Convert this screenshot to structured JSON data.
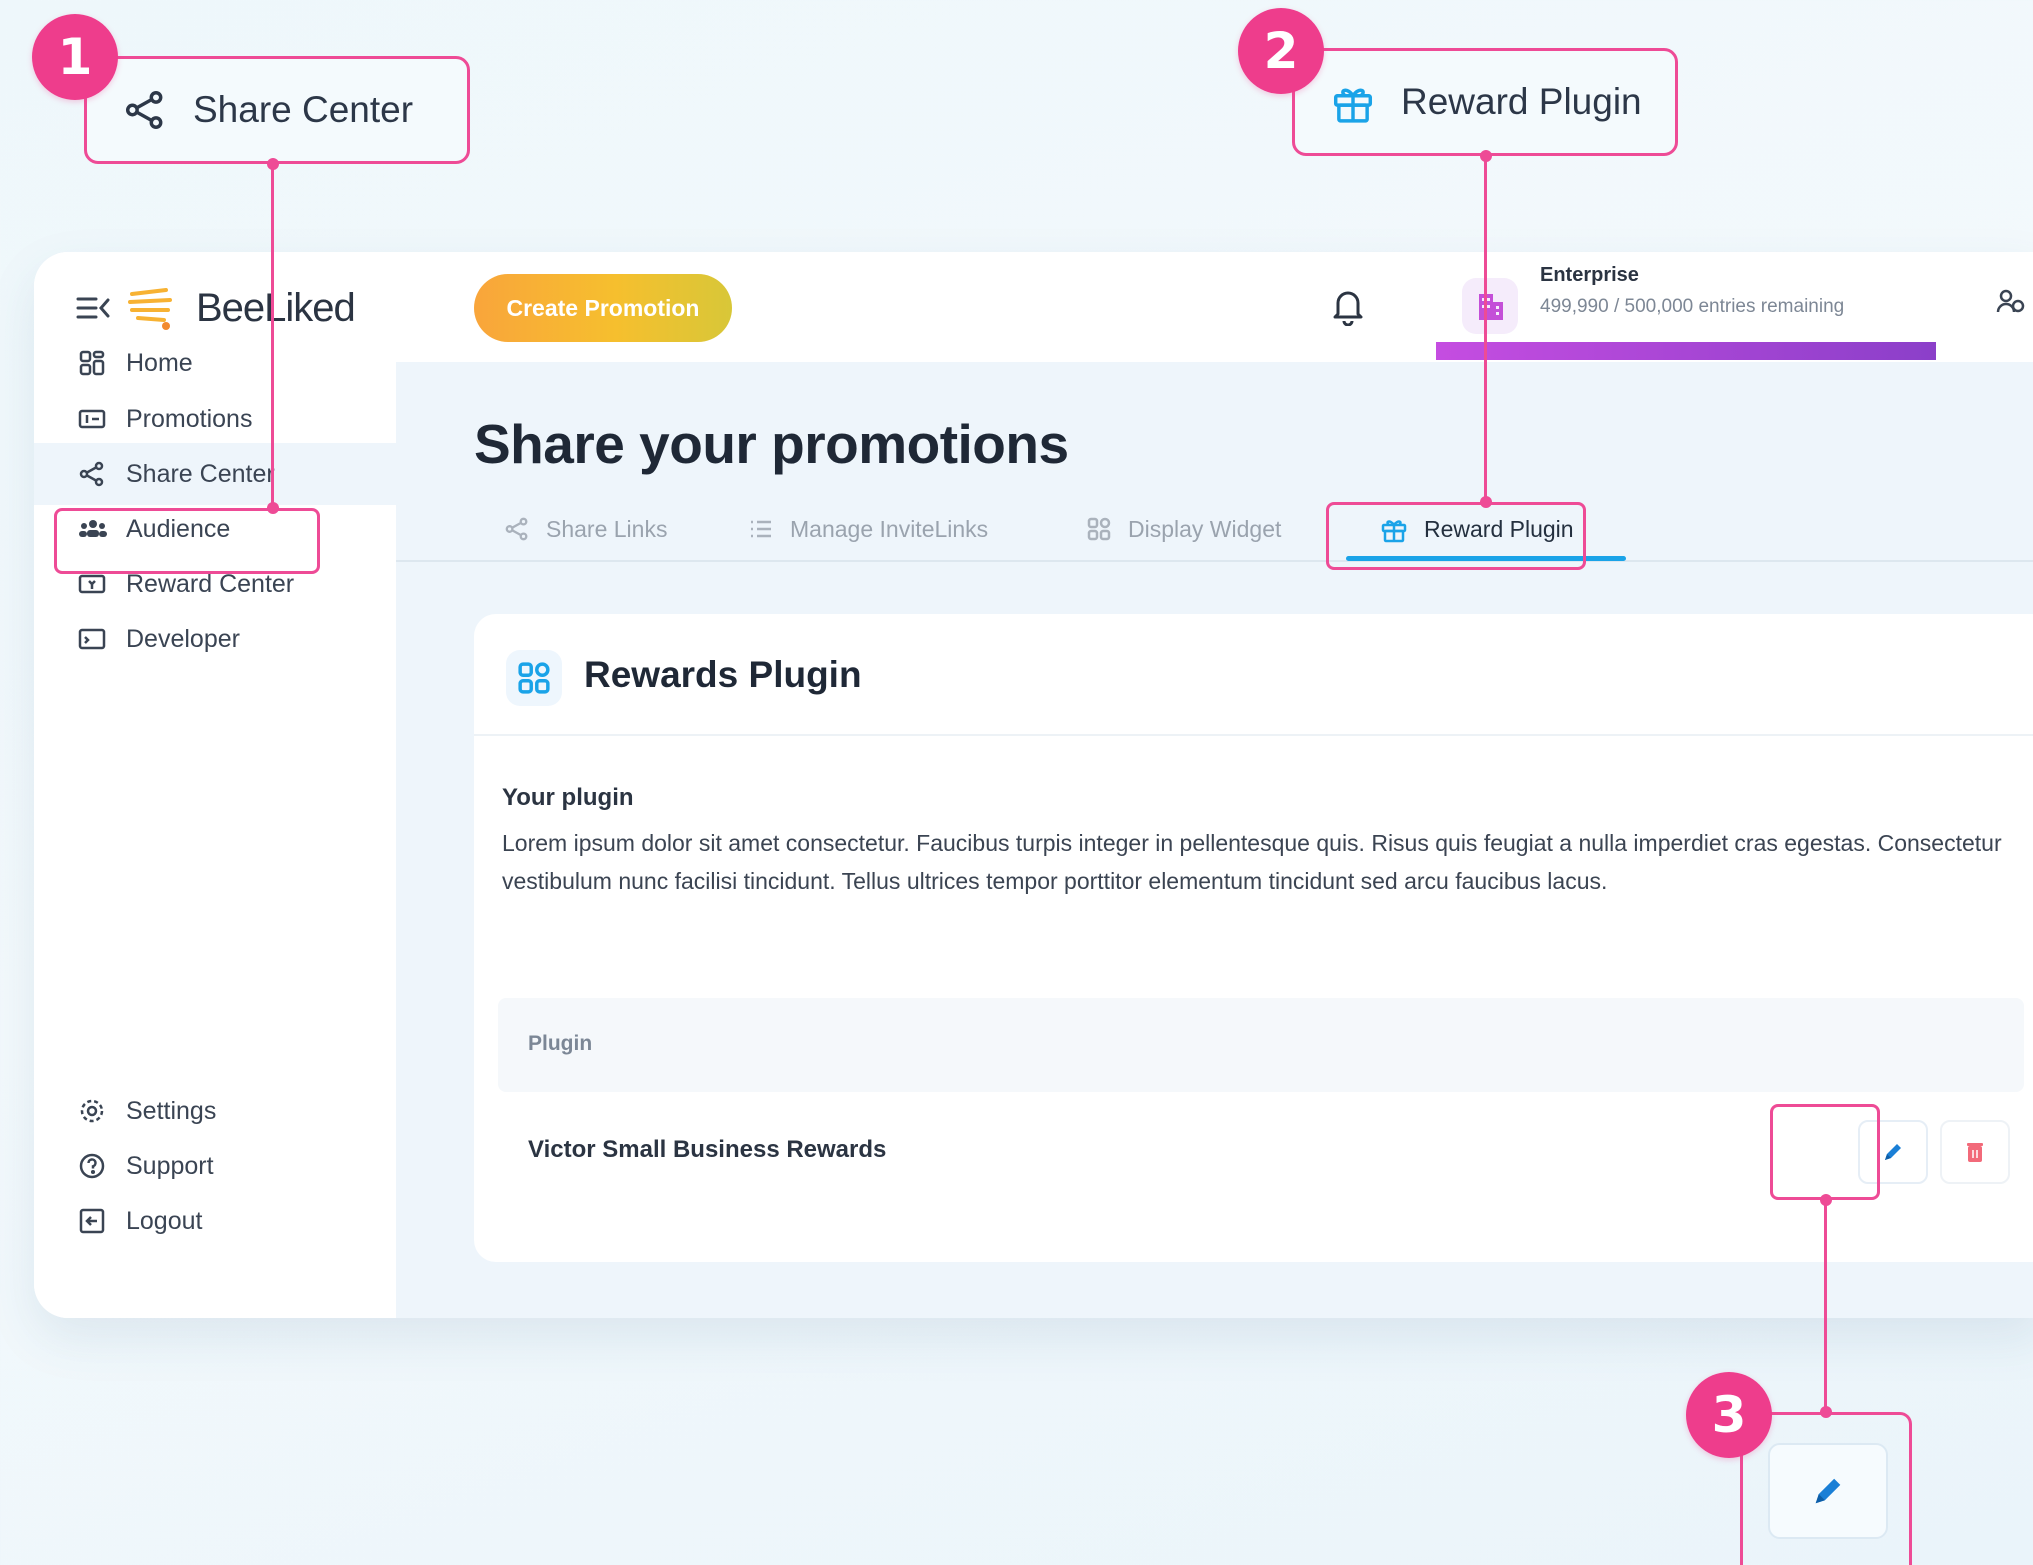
{
  "callouts": [
    {
      "number": "1",
      "label": "Share Center",
      "icon": "share-icon"
    },
    {
      "number": "2",
      "label": "Reward Plugin",
      "icon": "gift-icon"
    },
    {
      "number": "3",
      "icon": "pencil-icon"
    }
  ],
  "brand": {
    "name": "BeeLiked"
  },
  "sidebar": {
    "items": [
      {
        "label": "Home",
        "icon": "grid-icon"
      },
      {
        "label": "Promotions",
        "icon": "ticket-icon"
      },
      {
        "label": "Share Center",
        "icon": "share-icon",
        "active": true
      },
      {
        "label": "Audience",
        "icon": "people-icon"
      },
      {
        "label": "Reward Center",
        "icon": "reward-icon"
      },
      {
        "label": "Developer",
        "icon": "terminal-icon"
      }
    ],
    "bottom_items": [
      {
        "label": "Settings",
        "icon": "gear-icon"
      },
      {
        "label": "Support",
        "icon": "help-icon"
      },
      {
        "label": "Logout",
        "icon": "logout-icon"
      }
    ]
  },
  "topbar": {
    "create_label": "Create Promotion",
    "plan": {
      "name": "Enterprise",
      "entries": "499,990 / 500,000 entries remaining",
      "remaining_fraction": 0.99998
    }
  },
  "page": {
    "title": "Share your promotions",
    "tabs": [
      {
        "label": "Share Links",
        "icon": "share-icon"
      },
      {
        "label": "Manage InviteLinks",
        "icon": "list-icon"
      },
      {
        "label": "Display Widget",
        "icon": "widget-icon"
      },
      {
        "label": "Reward Plugin",
        "icon": "gift-icon",
        "active": true
      }
    ]
  },
  "card": {
    "title": "Rewards Plugin",
    "section_label": "Your plugin",
    "description": "Lorem ipsum dolor sit amet consectetur. Faucibus turpis integer in pellentesque quis. Risus quis feugiat a nulla imperdiet cras egestas. Consectetur vestibulum nunc facilisi tincidunt. Tellus ultrices tempor porttitor elementum tincidunt sed arcu faucibus lacus.",
    "table": {
      "columns": [
        "Plugin"
      ],
      "rows": [
        {
          "name": "Victor Small Business Rewards"
        }
      ]
    }
  },
  "colors": {
    "accent_pink": "#ee3d8c",
    "tab_underline": "#1aa3e8",
    "create_button": "#f7b233",
    "plan_bar": "#b047d8",
    "delete_red": "#f26a7a"
  }
}
